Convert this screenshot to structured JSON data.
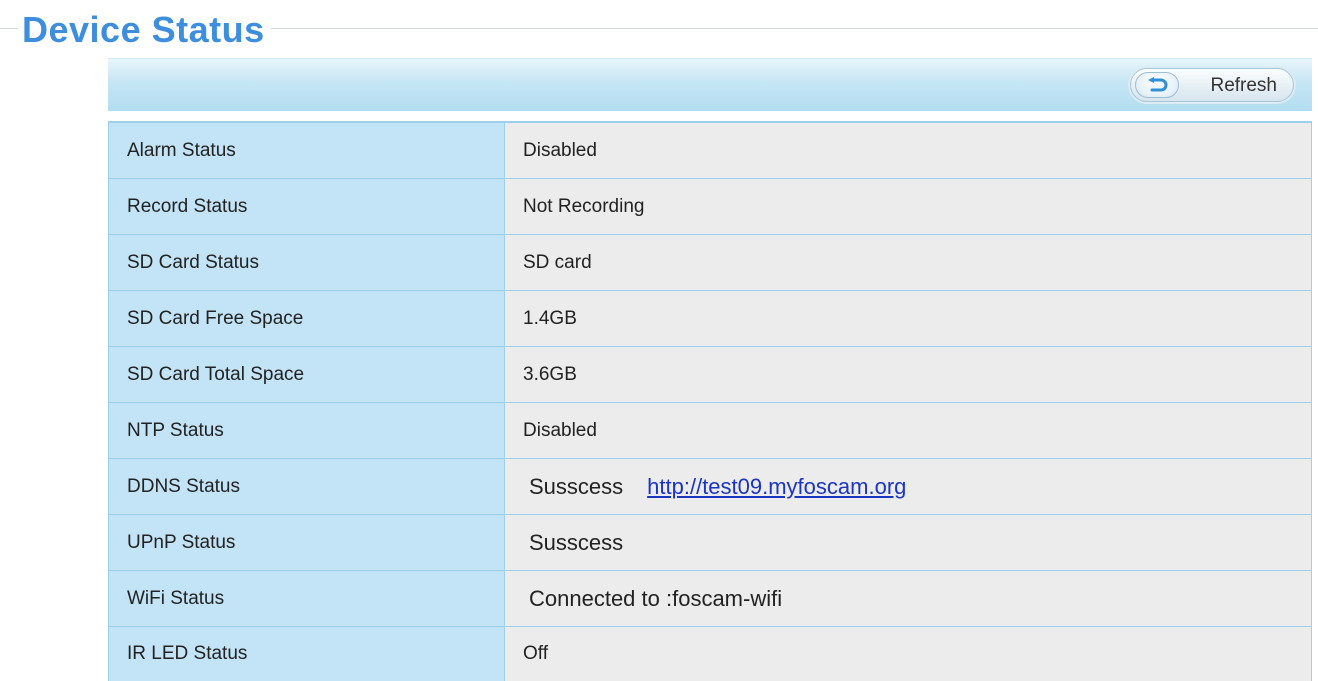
{
  "header": {
    "title": "Device Status"
  },
  "toolbar": {
    "refresh_label": "Refresh",
    "refresh_icon": "undo-arrow-icon"
  },
  "status_rows": [
    {
      "label": "Alarm Status",
      "value": "Disabled"
    },
    {
      "label": "Record Status",
      "value": "Not Recording"
    },
    {
      "label": "SD Card Status",
      "value": "SD card"
    },
    {
      "label": "SD Card Free Space",
      "value": "1.4GB"
    },
    {
      "label": "SD Card Total Space",
      "value": "3.6GB"
    },
    {
      "label": "NTP Status",
      "value": "Disabled"
    },
    {
      "label": "DDNS Status",
      "value": "Susscess",
      "link": "http://test09.myfoscam.org"
    },
    {
      "label": "UPnP Status",
      "value": "Susscess"
    },
    {
      "label": "WiFi Status",
      "value": "Connected to :foscam-wifi"
    },
    {
      "label": "IR LED Status",
      "value": "Off"
    }
  ],
  "colors": {
    "title": "#3d8ede",
    "label_cell_bg": "#c3e4f6",
    "value_cell_bg": "#ececec",
    "border": "#9fd0ea",
    "link": "#1a35c4"
  }
}
